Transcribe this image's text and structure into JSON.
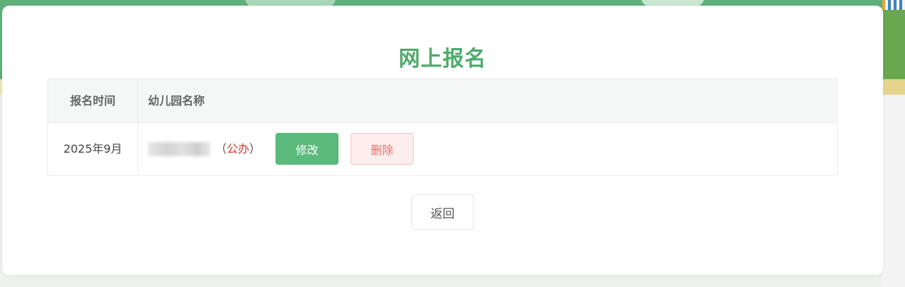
{
  "page": {
    "title": "网上报名"
  },
  "table": {
    "headers": {
      "time": "报名时间",
      "name": "幼儿园名称"
    },
    "rows": [
      {
        "time": "2025年9月",
        "name_prefix": "（",
        "type": "公办",
        "name_suffix": "）"
      }
    ]
  },
  "actions": {
    "edit_label": "修改",
    "delete_label": "删除",
    "back_label": "返回"
  },
  "colors": {
    "accent": "#4eab6c",
    "edit_button": "#5bb97b",
    "delete_text": "#e0716c",
    "type_text": "#d33b2e"
  }
}
